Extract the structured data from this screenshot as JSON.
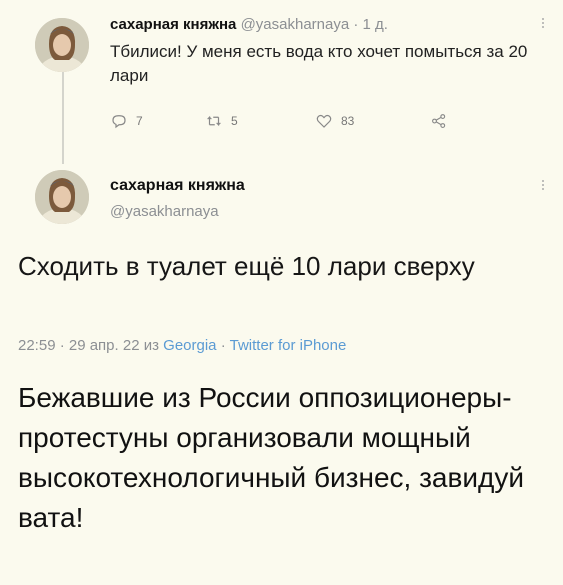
{
  "tweet1": {
    "display_name": "сахарная княжна",
    "handle": "@yasakharnaya",
    "separator": "·",
    "time": "1 д.",
    "text": "Тбилиси! У меня есть вода кто хочет помыться за 20 лари",
    "replies": "7",
    "retweets": "5",
    "likes": "83"
  },
  "tweet2": {
    "display_name": "сахарная княжна",
    "handle": "@yasakharnaya",
    "text": "Сходить в туалет ещё 10 лари сверху",
    "timestamp": "22:59 · 29 апр. 22 из",
    "location": "Georgia",
    "separator": "·",
    "client": "Twitter for iPhone"
  },
  "caption": "Бежавшие из России оппозиционеры-протестуны организовали мощный высокотехнологичный бизнес, завидуй вата!",
  "icons": {
    "reply": "reply-icon",
    "retweet": "retweet-icon",
    "like": "heart-icon",
    "share": "share-icon",
    "more": "more-icon"
  },
  "colors": {
    "background": "#fbfaee",
    "muted": "#8c8f93",
    "link": "#5b9bd3"
  }
}
